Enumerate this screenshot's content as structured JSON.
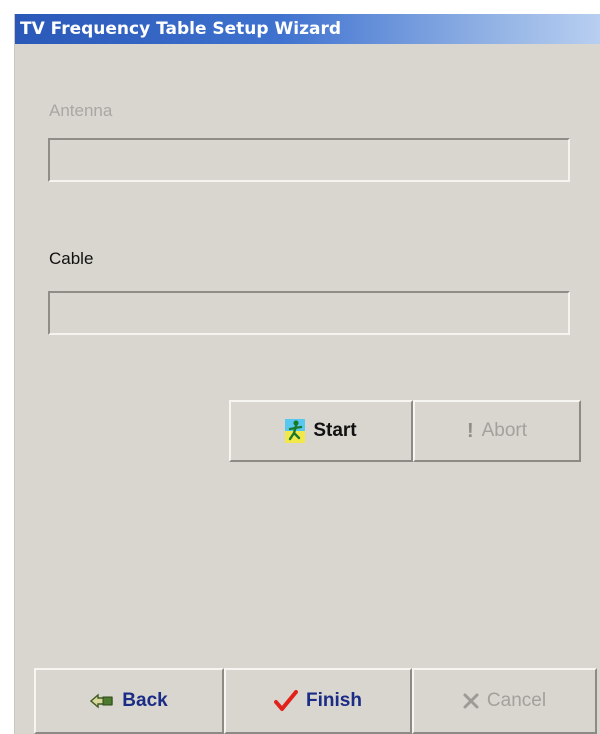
{
  "window": {
    "title": "TV Frequency Table Setup Wizard"
  },
  "antenna": {
    "label": "Antenna",
    "value": "",
    "enabled": false
  },
  "cable": {
    "label": "Cable",
    "value": "",
    "enabled": true
  },
  "scan_buttons": {
    "start": {
      "label": "Start",
      "icon": "running-man-icon",
      "enabled": true
    },
    "abort": {
      "label": "Abort",
      "icon": "exclamation-icon",
      "enabled": false
    }
  },
  "nav_buttons": {
    "back": {
      "label": "Back",
      "icon": "back-arrow-icon",
      "enabled": true
    },
    "finish": {
      "label": "Finish",
      "icon": "checkmark-icon",
      "enabled": true
    },
    "cancel": {
      "label": "Cancel",
      "icon": "x-icon",
      "enabled": false
    }
  },
  "colors": {
    "title_gradient_start": "#2a58b8",
    "title_gradient_end": "#b8cff0",
    "dialog_background": "#d8d6cf",
    "nav_text": "#1a2c86",
    "check_red": "#e0221a"
  }
}
